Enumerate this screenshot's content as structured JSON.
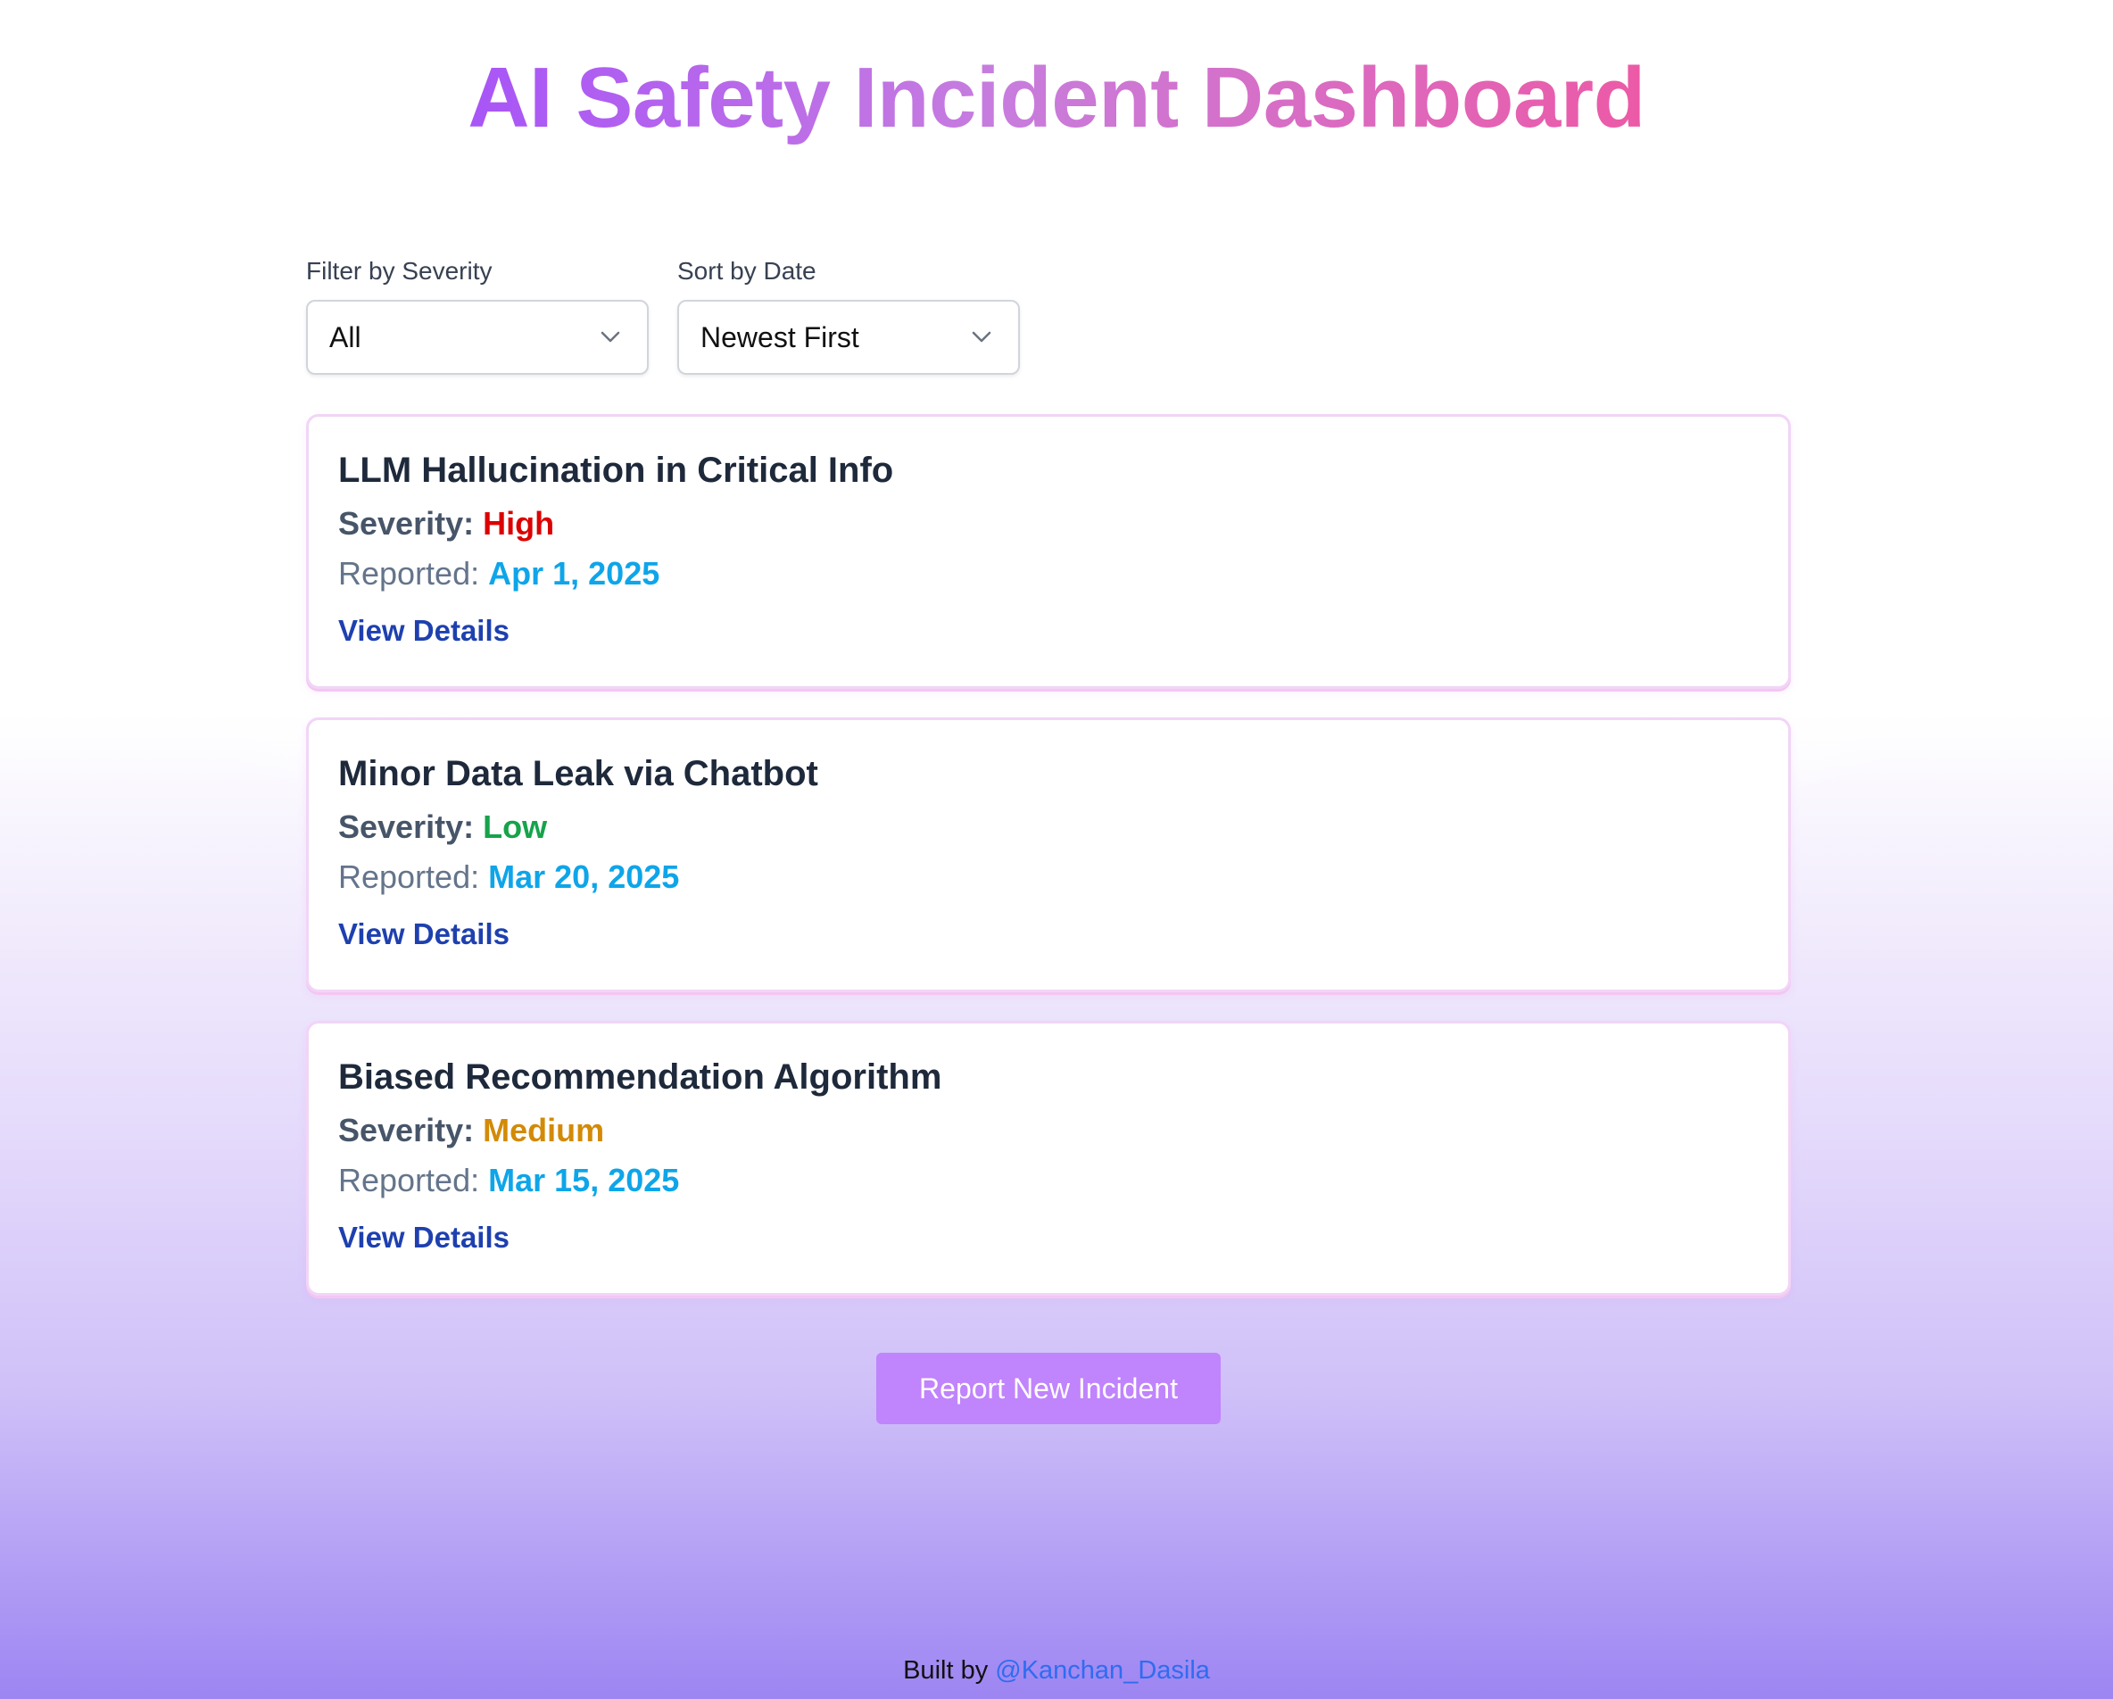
{
  "header": {
    "title": "AI Safety Incident Dashboard"
  },
  "filters": {
    "severity_label": "Filter by Severity",
    "severity_value": "All",
    "sort_label": "Sort by Date",
    "sort_value": "Newest First"
  },
  "incidents": [
    {
      "title": "LLM Hallucination in Critical Info",
      "severity_label": "Severity:",
      "severity": "High",
      "severity_color": "#dc0000",
      "reported_label": "Reported:",
      "date": "Apr 1, 2025",
      "link": "View Details"
    },
    {
      "title": "Minor Data Leak via Chatbot",
      "severity_label": "Severity:",
      "severity": "Low",
      "severity_color": "#16a34a",
      "reported_label": "Reported:",
      "date": "Mar 20, 2025",
      "link": "View Details"
    },
    {
      "title": "Biased Recommendation Algorithm",
      "severity_label": "Severity:",
      "severity": "Medium",
      "severity_color": "#d38a06",
      "reported_label": "Reported:",
      "date": "Mar 15, 2025",
      "link": "View Details"
    }
  ],
  "actions": {
    "report_label": "Report New Incident"
  },
  "footer": {
    "prefix": "Built by",
    "author": "@Kanchan_Dasila"
  },
  "icons": {
    "dropdown": "chevron-down-icon"
  },
  "colors": {
    "title_gradient_start": "#a855f7",
    "title_gradient_end": "#ec5aa6",
    "date": "#0ea5e9",
    "link": "#1e40af",
    "button": "#c084fc",
    "footer_link": "#2f6cf0"
  }
}
